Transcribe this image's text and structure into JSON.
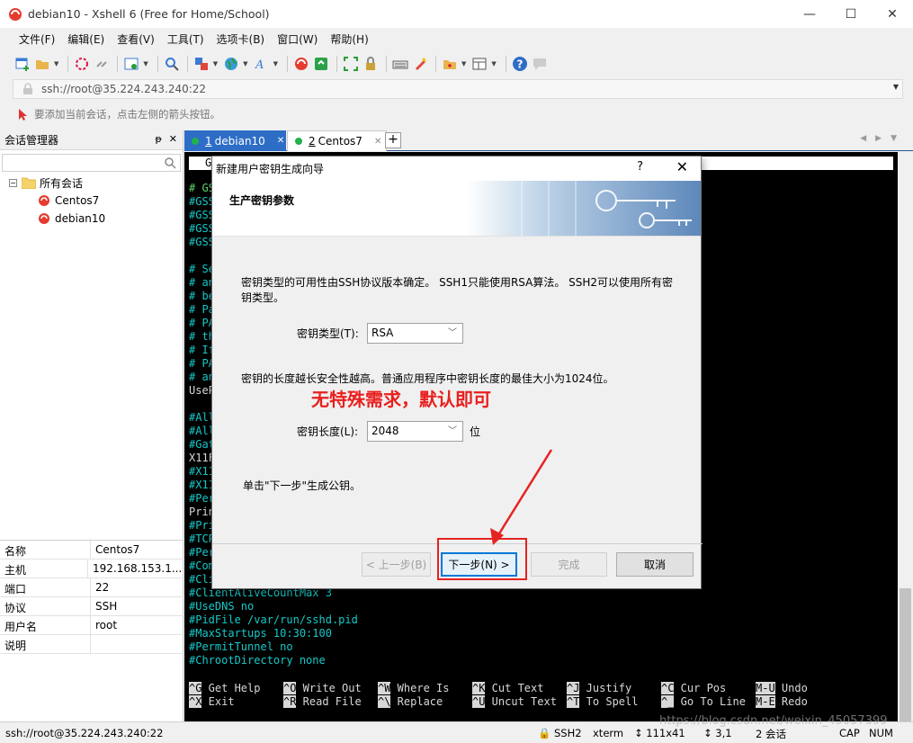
{
  "window": {
    "title": "debian10 - Xshell 6 (Free for Home/School)",
    "minimize": "—",
    "maximize": "☐",
    "close": "✕"
  },
  "menu": [
    "文件(F)",
    "编辑(E)",
    "查看(V)",
    "工具(T)",
    "选项卡(B)",
    "窗口(W)",
    "帮助(H)"
  ],
  "address": {
    "value": "ssh://root@35.224.243.240:22"
  },
  "hint": {
    "text": "要添加当前会话，点击左侧的箭头按钮。"
  },
  "session_manager": {
    "title": "会话管理器",
    "pin": "ᵽ",
    "close": "✕",
    "root_folder": "所有会话",
    "items": [
      "Centos7",
      "debian10"
    ]
  },
  "properties": [
    {
      "key": "名称",
      "value": "Centos7"
    },
    {
      "key": "主机",
      "value": "192.168.153.1..."
    },
    {
      "key": "端口",
      "value": "22"
    },
    {
      "key": "协议",
      "value": "SSH"
    },
    {
      "key": "用户名",
      "value": "root"
    },
    {
      "key": "说明",
      "value": ""
    }
  ],
  "tabs": [
    {
      "num": "1",
      "label": "debian10"
    },
    {
      "num": "2",
      "label": "Centos7"
    }
  ],
  "tab_add": "+",
  "terminal": {
    "top_line": "GN",
    "lines": [
      {
        "t": "# GSS",
        "c": "g"
      },
      {
        "t": "#GSS",
        "c": "c"
      },
      {
        "t": "#GSS",
        "c": "c"
      },
      {
        "t": "#GSS",
        "c": "c"
      },
      {
        "t": "#GSS",
        "c": "c"
      },
      {
        "t": "",
        "c": "c"
      },
      {
        "t": "# Se",
        "c": "c"
      },
      {
        "t": "# an",
        "c": "c"
      },
      {
        "t": "# be",
        "c": "c"
      },
      {
        "t": "# Pa",
        "c": "c"
      },
      {
        "t": "# PA",
        "c": "c"
      },
      {
        "t": "# th",
        "c": "c"
      },
      {
        "t": "# If",
        "c": "c"
      },
      {
        "t": "# PA",
        "c": "c"
      },
      {
        "t": "# an",
        "c": "c"
      },
      {
        "t": "UseP",
        "c": "w"
      },
      {
        "t": "",
        "c": "c"
      },
      {
        "t": "#All",
        "c": "c"
      },
      {
        "t": "#All",
        "c": "c"
      },
      {
        "t": "#Gat",
        "c": "c"
      },
      {
        "t": "X11F",
        "c": "w"
      },
      {
        "t": "#X11",
        "c": "c"
      },
      {
        "t": "#X11",
        "c": "c"
      },
      {
        "t": "#Per",
        "c": "c"
      },
      {
        "t": "Prin",
        "c": "w"
      },
      {
        "t": "#Pri",
        "c": "c"
      },
      {
        "t": "#TCP",
        "c": "c"
      },
      {
        "t": "#Per",
        "c": "c"
      },
      {
        "t": "#Com",
        "c": "c"
      },
      {
        "t": "#Cli",
        "c": "c"
      },
      {
        "t": "#ClientAliveCountMax 3",
        "c": "c"
      },
      {
        "t": "#UseDNS no",
        "c": "c"
      },
      {
        "t": "#PidFile /var/run/sshd.pid",
        "c": "c"
      },
      {
        "t": "#MaxStartups 10:30:100",
        "c": "c"
      },
      {
        "t": "#PermitTunnel no",
        "c": "c"
      },
      {
        "t": "#ChrootDirectory none",
        "c": "c"
      }
    ],
    "help_row1": [
      {
        "k": "^G",
        "l": " Get Help"
      },
      {
        "k": "^O",
        "l": " Write Out"
      },
      {
        "k": "^W",
        "l": " Where Is"
      },
      {
        "k": "^K",
        "l": " Cut Text"
      },
      {
        "k": "^J",
        "l": " Justify"
      },
      {
        "k": "^C",
        "l": " Cur Pos"
      },
      {
        "k": "M-U",
        "l": " Undo"
      }
    ],
    "help_row2": [
      {
        "k": "^X",
        "l": " Exit"
      },
      {
        "k": "^R",
        "l": " Read File"
      },
      {
        "k": "^\\",
        "l": " Replace"
      },
      {
        "k": "^U",
        "l": " Uncut Text"
      },
      {
        "k": "^T",
        "l": " To Spell"
      },
      {
        "k": "^_",
        "l": " Go To Line"
      },
      {
        "k": "M-E",
        "l": " Redo"
      }
    ]
  },
  "status": {
    "address": "ssh://root@35.224.243.240:22",
    "protocol": "SSH2",
    "term": "xterm",
    "size": "111x41",
    "pos": "3,1",
    "sessions": "2 会话",
    "cap": "CAP",
    "num": "NUM"
  },
  "watermark": "https://blog.csdn.net/weixin_45057399",
  "dialog": {
    "title": "新建用户密钥生成向导",
    "help": "?",
    "close": "✕",
    "heading": "生产密钥参数",
    "para1": "密钥类型的可用性由SSH协议版本确定。 SSH1只能使用RSA算法。 SSH2可以使用所有密钥类型。",
    "type_label": "密钥类型(T):",
    "type_value": "RSA",
    "para2": "密钥的长度越长安全性越高。普通应用程序中密钥长度的最佳大小为1024位。",
    "annotation": "无特殊需求，默认即可",
    "length_label": "密钥长度(L):",
    "length_value": "2048",
    "length_unit": "位",
    "para3": "单击\"下一步\"生成公钥。",
    "btn_back": "< 上一步(B)",
    "btn_next": "下一步(N) >",
    "btn_finish": "完成",
    "btn_cancel": "取消"
  },
  "colors": {
    "accent_tab": "#2d6dc6",
    "terminal_bg": "#000000",
    "terminal_comment": "#18c9c9",
    "annotation_red": "#e8201e"
  }
}
